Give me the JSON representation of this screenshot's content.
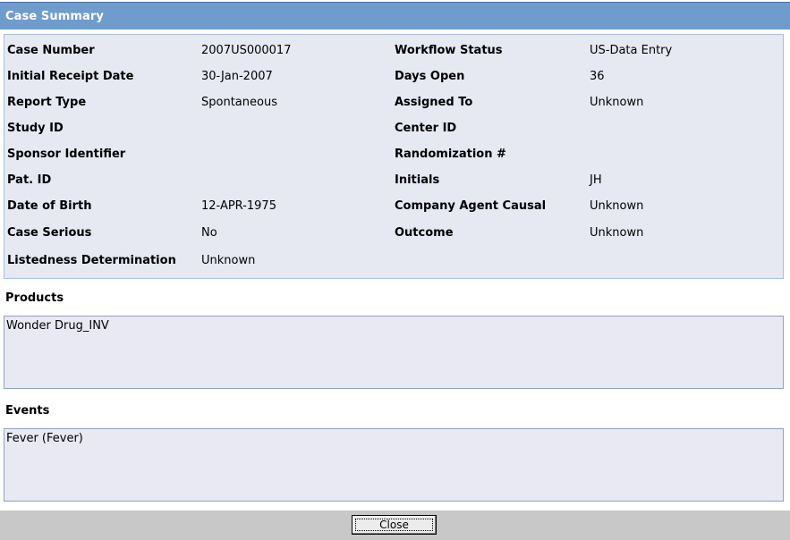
{
  "window": {
    "title": "Case Summary"
  },
  "summary": {
    "rows": [
      {
        "label1": "Case Number",
        "value1": "2007US000017",
        "label2": "Workflow Status",
        "value2": "US-Data Entry"
      },
      {
        "label1": "Initial Receipt Date",
        "value1": "30-Jan-2007",
        "label2": "Days Open",
        "value2": "36"
      },
      {
        "label1": "Report Type",
        "value1": "Spontaneous",
        "label2": "Assigned To",
        "value2": "Unknown"
      },
      {
        "label1": "Study ID",
        "value1": "",
        "label2": "Center ID",
        "value2": ""
      },
      {
        "label1": "Sponsor Identifier",
        "value1": "",
        "label2": "Randomization #",
        "value2": ""
      },
      {
        "label1": "Pat. ID",
        "value1": "",
        "label2": "Initials",
        "value2": "JH"
      },
      {
        "label1": "Date of Birth",
        "value1": "12-APR-1975",
        "label2": "Company Agent Causal",
        "value2": "Unknown"
      },
      {
        "label1": "Case Serious",
        "value1": "No",
        "label2": "Outcome",
        "value2": "Unknown"
      },
      {
        "label1": "Listedness Determination",
        "value1": "Unknown",
        "label2": "",
        "value2": ""
      }
    ]
  },
  "products": {
    "heading": "Products",
    "items": [
      "Wonder Drug_INV"
    ]
  },
  "events": {
    "heading": "Events",
    "items": [
      "Fever (Fever)"
    ]
  },
  "footer": {
    "close_label": "Close"
  },
  "colors": {
    "title_bar": "#6f9ccd",
    "panel_bg": "#e6e8f2",
    "panel_border": "#a7bfe0",
    "footer_bg": "#c8c8c8"
  }
}
